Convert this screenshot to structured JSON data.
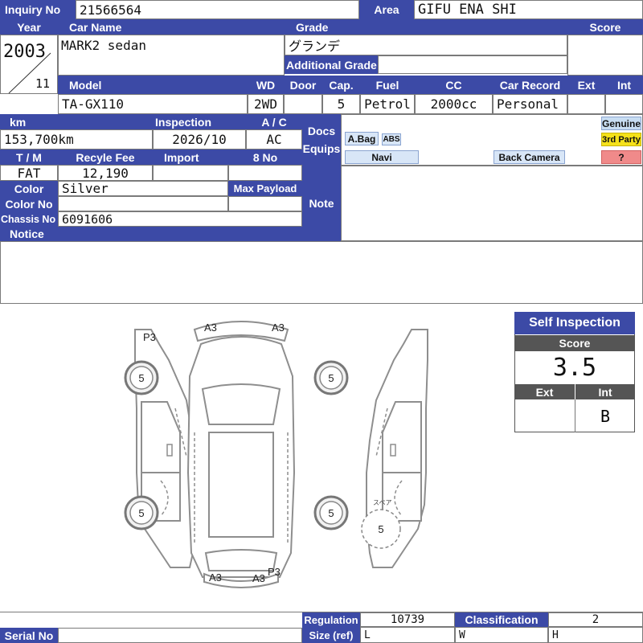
{
  "labels": {
    "inquiry_no": "Inquiry No",
    "area": "Area",
    "year": "Year",
    "car_name": "Car Name",
    "grade": "Grade",
    "score": "Score",
    "additional_grade": "Additional Grade",
    "model": "Model",
    "wd": "WD",
    "door": "Door",
    "cap": "Cap.",
    "fuel": "Fuel",
    "cc": "CC",
    "car_record": "Car Record",
    "ext": "Ext",
    "int": "Int",
    "km": "km",
    "inspection": "Inspection",
    "ac": "A / C",
    "docs": "Docs",
    "equips": "Equips",
    "genuine": "Genuine",
    "third_party": "3rd Party",
    "tm": "T / M",
    "recycle_fee": "Recyle Fee",
    "import": "Import",
    "no8": "8 No",
    "color": "Color",
    "max_payload": "Max Payload",
    "color_no": "Color No",
    "note": "Note",
    "chassis_no": "Chassis No",
    "notice": "Notice",
    "regulation": "Regulation",
    "classification": "Classification",
    "size_ref": "Size (ref)",
    "serial_no": "Serial No"
  },
  "vehicle": {
    "inquiry_no": "21566564",
    "area": "GIFU ENA SHI",
    "year": "2003",
    "month": "11",
    "car_name": "MARK2 sedan",
    "grade": "グランデ",
    "additional_grade": "",
    "score": "",
    "model": "TA-GX110",
    "wd": "2WD",
    "door": "",
    "cap": "5",
    "fuel": "Petrol",
    "cc": "2000cc",
    "car_record": "Personal",
    "ext": "",
    "int": "",
    "km": "153,700km",
    "inspection": "2026/10",
    "ac": "AC",
    "tm": "FAT",
    "recycle_fee": "12,190",
    "import": "",
    "no8": "",
    "color": "Silver",
    "max_payload": "",
    "color_no": "",
    "chassis_no": "6091606",
    "notice": "",
    "note": ""
  },
  "equipment": {
    "airbag": "A.Bag",
    "abs": "ABS",
    "navi": "Navi",
    "back_camera": "Back Camera",
    "unknown": "?"
  },
  "self_inspection": {
    "title": "Self Inspection",
    "score_label": "Score",
    "score": "3.5",
    "ext_label": "Ext",
    "int_label": "Int",
    "ext": "",
    "int": "B"
  },
  "diagram": {
    "marks": [
      "P3",
      "A3",
      "A3",
      "A3",
      "A3",
      "P3"
    ],
    "tires": [
      "5",
      "5",
      "5",
      "5"
    ],
    "spare_label": "スペア",
    "spare": "5"
  },
  "footer": {
    "regulation": "10739",
    "classification": "2",
    "size_l": "L",
    "size_w": "W",
    "size_h": "H",
    "serial_no": ""
  },
  "colors": {
    "header_bg": "#3c4aa6",
    "equip_bg": "#d8e6f7",
    "genuine_bg": "#c8ddf2",
    "third_party_bg": "#f5e11a",
    "unknown_bg": "#f08a8a"
  }
}
